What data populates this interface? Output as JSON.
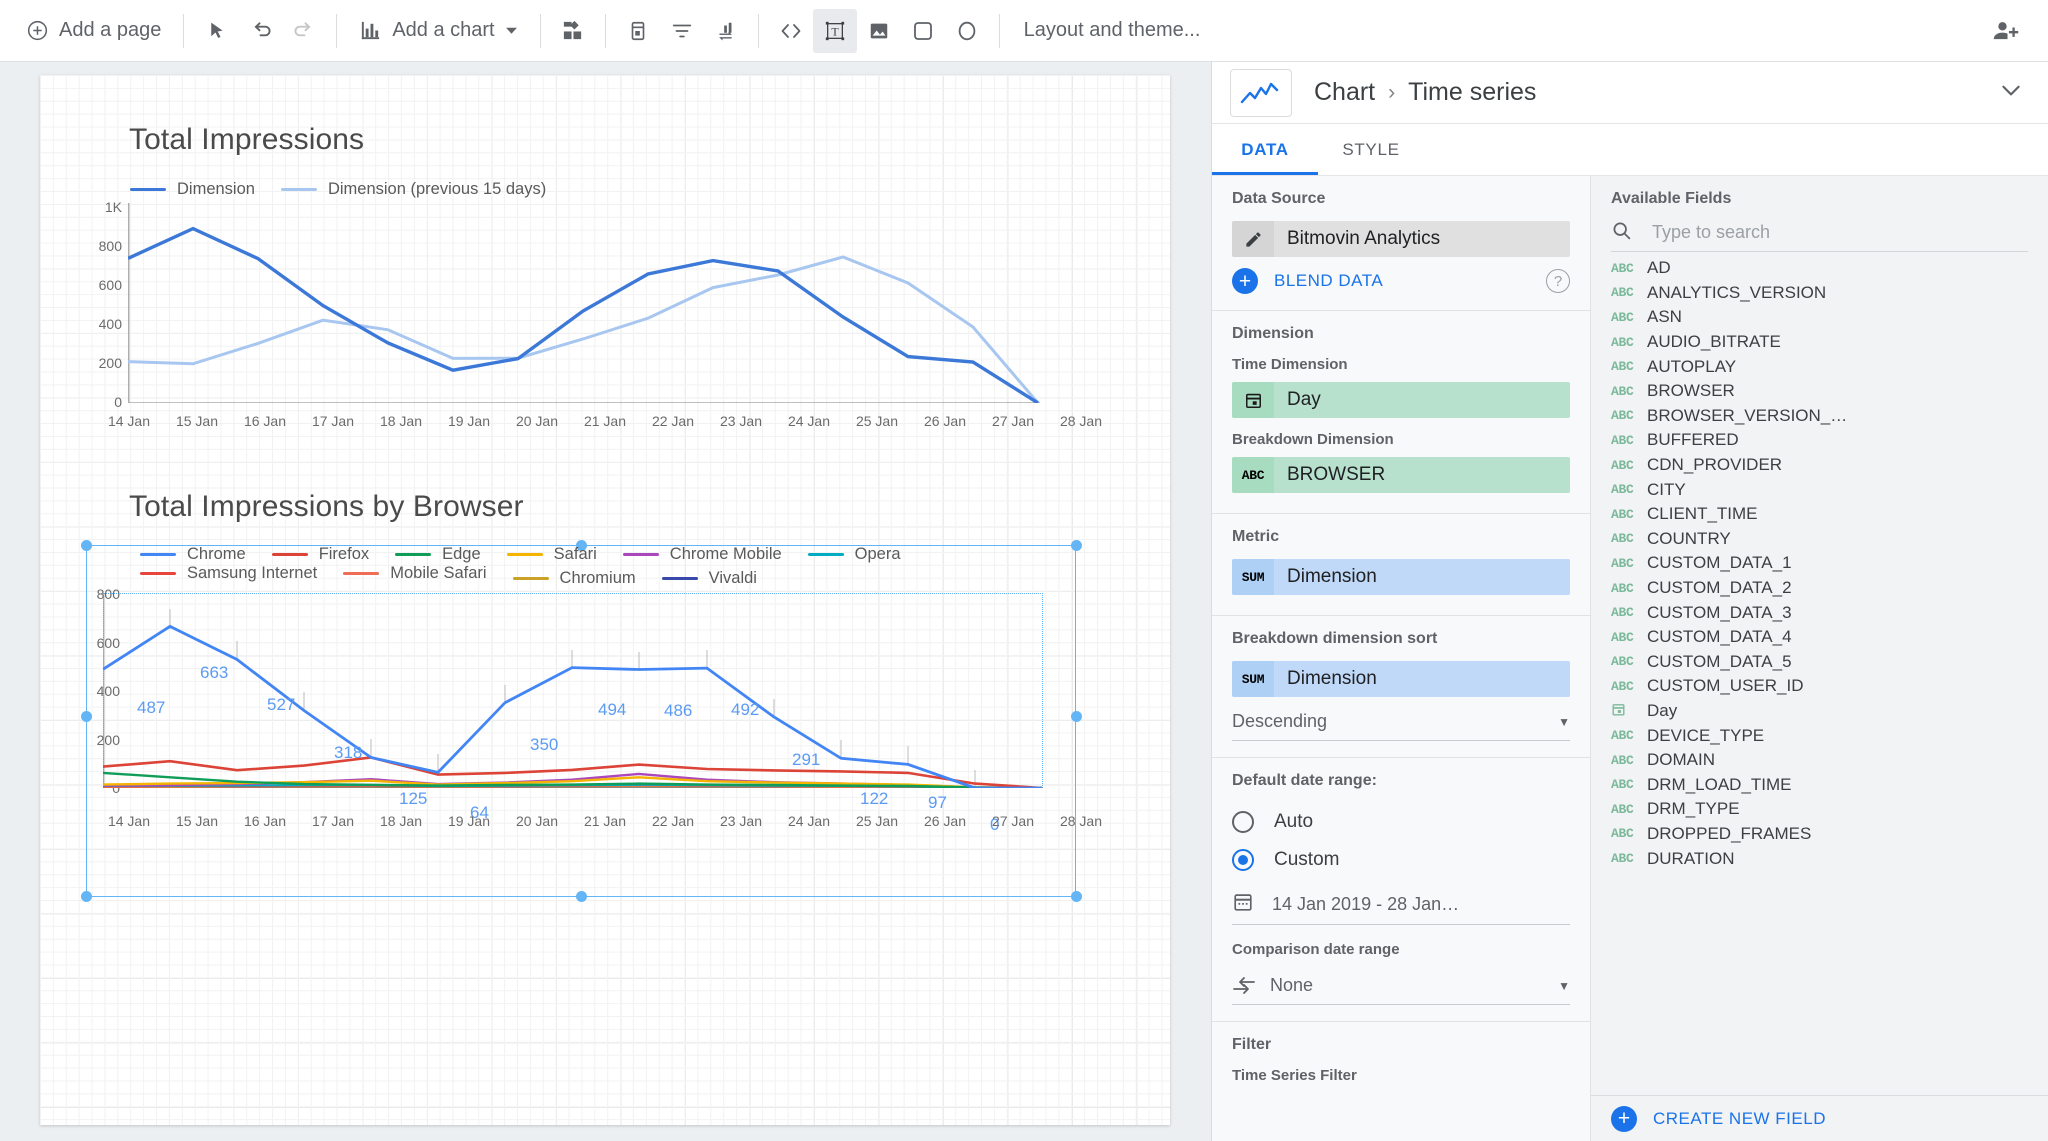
{
  "toolbar": {
    "add_page": "Add a page",
    "add_chart": "Add a chart",
    "layout_theme": "Layout and theme...",
    "icons": {
      "select": "cursor-icon",
      "undo": "undo-icon",
      "redo": "redo-icon",
      "community": "community-visualization-icon",
      "control": "date-control-icon",
      "filter": "filter-control-icon",
      "sort": "sort-control-icon",
      "embed": "embed-code-icon",
      "text": "text-box-icon",
      "image": "image-icon",
      "rect": "rectangle-icon",
      "circle": "circle-icon",
      "share": "add-person-icon"
    }
  },
  "panel": {
    "breadcrumb_root": "Chart",
    "breadcrumb_sep": "›",
    "breadcrumb_leaf": "Time series",
    "tabs": [
      {
        "label": "DATA",
        "active": true
      },
      {
        "label": "STYLE",
        "active": false
      }
    ],
    "data_source": {
      "header": "Data Source",
      "name": "Bitmovin Analytics",
      "blend_label": "BLEND DATA"
    },
    "dimension": {
      "header": "Dimension",
      "time_label": "Time Dimension",
      "time_value": "Day",
      "breakdown_label": "Breakdown Dimension",
      "breakdown_value": "BROWSER",
      "breakdown_badge": "ABC"
    },
    "metric": {
      "header": "Metric",
      "agg": "SUM",
      "value": "Dimension"
    },
    "sort": {
      "header": "Breakdown dimension sort",
      "agg": "SUM",
      "value": "Dimension",
      "direction": "Descending"
    },
    "date_range": {
      "header": "Default date range:",
      "auto": "Auto",
      "custom": "Custom",
      "custom_selected": true,
      "value": "14 Jan 2019 - 28 Jan…",
      "comparison_header": "Comparison date range",
      "comparison_value": "None"
    },
    "filter": {
      "header": "Filter",
      "item": "Time Series Filter"
    },
    "available_fields": {
      "header": "Available Fields",
      "search_placeholder": "Type to search",
      "create_new": "CREATE NEW FIELD",
      "items": [
        {
          "name": "AD",
          "type": "ABC"
        },
        {
          "name": "ANALYTICS_VERSION",
          "type": "ABC"
        },
        {
          "name": "ASN",
          "type": "ABC"
        },
        {
          "name": "AUDIO_BITRATE",
          "type": "ABC"
        },
        {
          "name": "AUTOPLAY",
          "type": "ABC"
        },
        {
          "name": "BROWSER",
          "type": "ABC"
        },
        {
          "name": "BROWSER_VERSION_…",
          "type": "ABC"
        },
        {
          "name": "BUFFERED",
          "type": "ABC"
        },
        {
          "name": "CDN_PROVIDER",
          "type": "ABC"
        },
        {
          "name": "CITY",
          "type": "ABC"
        },
        {
          "name": "CLIENT_TIME",
          "type": "ABC"
        },
        {
          "name": "COUNTRY",
          "type": "ABC"
        },
        {
          "name": "CUSTOM_DATA_1",
          "type": "ABC"
        },
        {
          "name": "CUSTOM_DATA_2",
          "type": "ABC"
        },
        {
          "name": "CUSTOM_DATA_3",
          "type": "ABC"
        },
        {
          "name": "CUSTOM_DATA_4",
          "type": "ABC"
        },
        {
          "name": "CUSTOM_DATA_5",
          "type": "ABC"
        },
        {
          "name": "CUSTOM_USER_ID",
          "type": "ABC"
        },
        {
          "name": "Day",
          "type": "DATE"
        },
        {
          "name": "DEVICE_TYPE",
          "type": "ABC"
        },
        {
          "name": "DOMAIN",
          "type": "ABC"
        },
        {
          "name": "DRM_LOAD_TIME",
          "type": "ABC"
        },
        {
          "name": "DRM_TYPE",
          "type": "ABC"
        },
        {
          "name": "DROPPED_FRAMES",
          "type": "ABC"
        },
        {
          "name": "DURATION",
          "type": "ABC"
        }
      ]
    }
  },
  "chart_data": [
    {
      "type": "line",
      "title": "Total Impressions",
      "xlabel": "",
      "ylabel": "",
      "ylim": [
        0,
        1000
      ],
      "yticks": [
        "0",
        "200",
        "400",
        "600",
        "800",
        "1K"
      ],
      "grid": true,
      "legend_position": "top-left",
      "categories": [
        "14 Jan",
        "15 Jan",
        "16 Jan",
        "17 Jan",
        "18 Jan",
        "19 Jan",
        "20 Jan",
        "21 Jan",
        "22 Jan",
        "23 Jan",
        "24 Jan",
        "25 Jan",
        "26 Jan",
        "27 Jan",
        "28 Jan"
      ],
      "series": [
        {
          "name": "Dimension",
          "color": "#3c78d8",
          "values": [
            723,
            872,
            722,
            487,
            300,
            164,
            222,
            460,
            645,
            712,
            660,
            430,
            232,
            205,
            0
          ]
        },
        {
          "name": "Dimension (previous 15 days)",
          "color": "#a8c7f0",
          "values": [
            207,
            196,
            298,
            414,
            366,
            223,
            224,
            320,
            424,
            577,
            640,
            730,
            600,
            380,
            0
          ]
        }
      ]
    },
    {
      "type": "line",
      "title": "Total Impressions by Browser",
      "xlabel": "",
      "ylabel": "",
      "ylim": [
        0,
        800
      ],
      "yticks": [
        "0",
        "200",
        "400",
        "600",
        "800"
      ],
      "grid": true,
      "legend_position": "top",
      "categories": [
        "14 Jan",
        "15 Jan",
        "16 Jan",
        "17 Jan",
        "18 Jan",
        "19 Jan",
        "20 Jan",
        "21 Jan",
        "22 Jan",
        "23 Jan",
        "24 Jan",
        "25 Jan",
        "26 Jan",
        "27 Jan",
        "28 Jan"
      ],
      "data_labels": [
        487,
        663,
        527,
        318,
        125,
        64,
        350,
        494,
        486,
        492,
        291,
        122,
        97,
        0
      ],
      "series": [
        {
          "name": "Chrome",
          "color": "#4285f4",
          "values": [
            487,
            663,
            527,
            318,
            125,
            64,
            350,
            494,
            486,
            492,
            291,
            122,
            97,
            0,
            0
          ]
        },
        {
          "name": "Firefox",
          "color": "#db4437",
          "values": [
            88,
            110,
            73,
            92,
            125,
            55,
            62,
            74,
            96,
            78,
            72,
            68,
            62,
            18,
            0
          ]
        },
        {
          "name": "Edge",
          "color": "#0f9d58",
          "values": [
            62,
            44,
            26,
            16,
            13,
            10,
            12,
            14,
            18,
            14,
            12,
            10,
            8,
            2,
            0
          ]
        },
        {
          "name": "Safari",
          "color": "#f4b400",
          "values": [
            14,
            18,
            20,
            24,
            30,
            14,
            20,
            28,
            44,
            28,
            22,
            18,
            14,
            3,
            0
          ]
        },
        {
          "name": "Chrome Mobile",
          "color": "#ab47bc",
          "values": [
            10,
            12,
            16,
            24,
            36,
            16,
            22,
            34,
            58,
            34,
            24,
            18,
            12,
            2,
            0
          ]
        },
        {
          "name": "Opera",
          "color": "#00acc1",
          "values": [
            8,
            9,
            10,
            11,
            12,
            7,
            9,
            11,
            13,
            11,
            9,
            8,
            6,
            1,
            0
          ]
        },
        {
          "name": "Samsung Internet",
          "color": "#e8453c",
          "values": [
            6,
            7,
            8,
            9,
            10,
            6,
            8,
            10,
            12,
            10,
            8,
            7,
            5,
            1,
            0
          ]
        },
        {
          "name": "Mobile Safari",
          "color": "#ef6c57",
          "values": [
            5,
            6,
            6,
            7,
            8,
            5,
            6,
            8,
            10,
            8,
            6,
            5,
            4,
            1,
            0
          ]
        },
        {
          "name": "Chromium",
          "color": "#c9a227",
          "values": [
            4,
            4,
            5,
            5,
            6,
            4,
            5,
            6,
            7,
            6,
            5,
            4,
            3,
            1,
            0
          ]
        },
        {
          "name": "Vivaldi",
          "color": "#3949ab",
          "values": [
            3,
            3,
            4,
            4,
            5,
            3,
            4,
            5,
            6,
            5,
            4,
            3,
            2,
            1,
            0
          ]
        }
      ]
    }
  ]
}
